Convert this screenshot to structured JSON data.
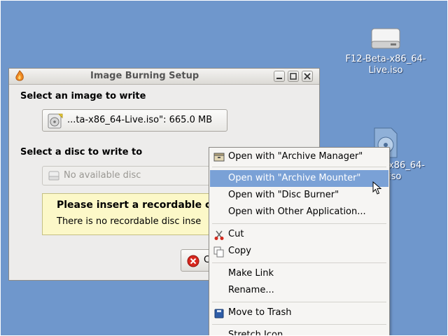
{
  "desktop": {
    "icons": [
      {
        "name": "F12-Beta-x86_64-Live.iso",
        "icon": "drive-icon"
      },
      {
        "name": "...x86_64-iso",
        "icon": "disc-image-icon"
      }
    ]
  },
  "dialog": {
    "title": "Image Burning Setup",
    "select_image_label": "Select an image to write",
    "image_file": "...ta-x86_64-Live.iso\": 665.0 MB",
    "select_disc_label": "Select a disc to write to",
    "disc_placeholder": "No available disc",
    "info_title": "Please insert a recordable c",
    "info_text": "There is no recordable disc inse",
    "cancel_label": "C"
  },
  "context_menu": {
    "items": [
      {
        "label": "Open with \"Archive Manager\"",
        "icon": "archive-icon"
      },
      {
        "label": "Open with \"Archive Mounter\"",
        "highlighted": true
      },
      {
        "label": "Open with \"Disc Burner\""
      },
      {
        "label": "Open with Other Application..."
      },
      {
        "label": "Cut",
        "icon": "scissors-icon"
      },
      {
        "label": "Copy",
        "icon": "copy-icon"
      },
      {
        "label": "Make Link"
      },
      {
        "label": "Rename..."
      },
      {
        "label": "Move to Trash",
        "icon": "trash-icon"
      },
      {
        "label": "Stretch Icon"
      }
    ]
  },
  "colors": {
    "desktop_bg": "#6f97cc",
    "menu_highlight": "#7aa1d6",
    "info_bg": "#fcf8c8"
  }
}
